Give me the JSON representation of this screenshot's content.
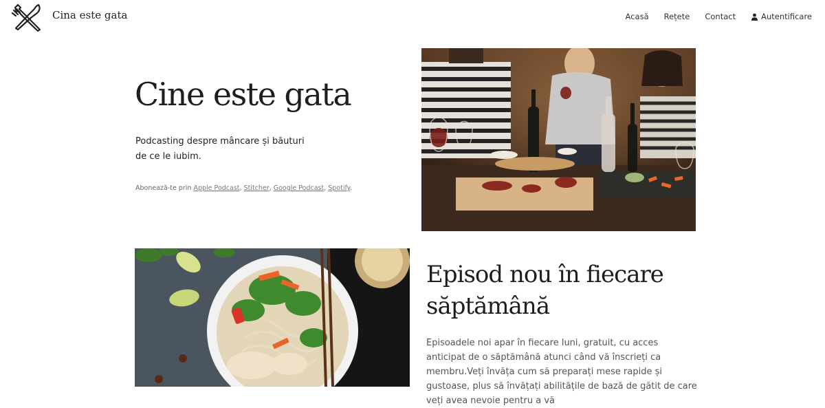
{
  "header": {
    "site_title": "Cina este gata",
    "logo_icon": "fork-knife-crossed-icon",
    "nav": [
      {
        "label": "Acasă"
      },
      {
        "label": "Rețete"
      },
      {
        "label": "Contact"
      },
      {
        "label": "Autentificare",
        "icon": "user-icon"
      }
    ]
  },
  "hero": {
    "title": "Cine este gata",
    "desc_line1": "Podcasting despre mâncare și băuturi",
    "desc_line2": "de ce le iubim.",
    "subscribe_prefix": "Abonează-te prin ",
    "links": [
      "Apple Podcast",
      "Stitcher",
      "Google Podcast",
      "Spotify"
    ],
    "sep1": ", ",
    "sep2": ", ",
    "sep3": ", ",
    "end": "."
  },
  "episode": {
    "title_line1": "Episod nou în fiecare",
    "title_line2": "săptămână",
    "body": "Episoadele noi apar în fiecare luni, gratuit, cu acces anticipat de o săptămână atunci când vă înscrieți ca membru.Veți învăța cum să preparați mese rapide și gustoase, plus să învățați abilitățile de bază de gătit de care veți avea nevoie pentru a vă"
  }
}
